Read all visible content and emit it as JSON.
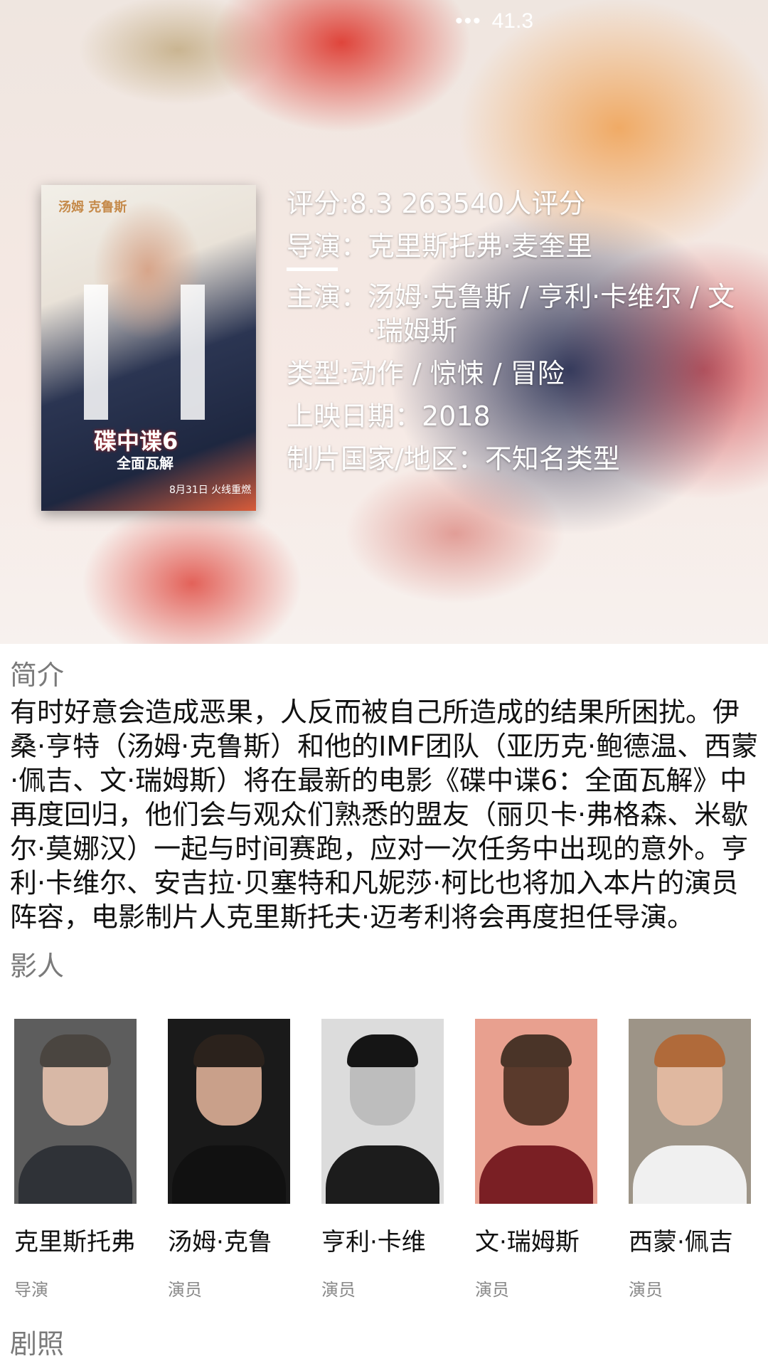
{
  "status": {
    "battery_text": "41.3",
    "more_icon": "more-dots-icon"
  },
  "poster": {
    "title": "碟中谍6",
    "subtitle": "全面瓦解",
    "corner_text": "汤姆 克鲁斯",
    "date_text": "8月31日 火线重燃"
  },
  "info": {
    "rating": "评分:8.3 263540人评分",
    "director_label": "导演：",
    "director_value": "克里斯托弗·麦奎里",
    "actors_label": "主演：",
    "actors_value": "汤姆·克鲁斯 / 亨利·卡维尔 / 文·瑞姆斯",
    "genre": "类型:动作 / 惊悚 / 冒险",
    "release": "上映日期：2018",
    "region": "制片国家/地区：不知名类型"
  },
  "sections": {
    "intro_title": "简介",
    "cast_title": "影人",
    "stills_title": "剧照"
  },
  "intro_text": "有时好意会造成恶果，人反而被自己所造成的结果所困扰。伊桑·亨特（汤姆·克鲁斯）和他的IMF团队（亚历克·鲍德温、西蒙·佩吉、文·瑞姆斯）将在最新的电影《碟中谍6：全面瓦解》中再度回归，他们会与观众们熟悉的盟友（丽贝卡·弗格森、米歇尔·莫娜汉）一起与时间赛跑，应对一次任务中出现的意外。亨利·卡维尔、安吉拉·贝塞特和凡妮莎·柯比也将加入本片的演员阵容，电影制片人克里斯托夫·迈考利将会再度担任导演。",
  "cast": [
    {
      "name": "克里斯托弗",
      "role": "导演",
      "colors": {
        "bg": "#5d5d5d",
        "skin": "#d8b8a6",
        "hair": "#4a4540",
        "body": "#2f3237"
      }
    },
    {
      "name": "汤姆·克鲁",
      "role": "演员",
      "colors": {
        "bg": "#1a1a1a",
        "skin": "#c9a08a",
        "hair": "#2b221c",
        "body": "#111111"
      }
    },
    {
      "name": "亨利·卡维",
      "role": "演员",
      "colors": {
        "bg": "#dcdcdc",
        "skin": "#bdbdbd",
        "hair": "#151515",
        "body": "#1c1c1c"
      }
    },
    {
      "name": "文·瑞姆斯",
      "role": "演员",
      "colors": {
        "bg": "#e8a08f",
        "skin": "#5a3a2c",
        "hair": "#4a3428",
        "body": "#7a1f24"
      }
    },
    {
      "name": "西蒙·佩吉",
      "role": "演员",
      "colors": {
        "bg": "#9d9487",
        "skin": "#e0b8a0",
        "hair": "#b06a3a",
        "body": "#f0f0f0"
      }
    }
  ]
}
